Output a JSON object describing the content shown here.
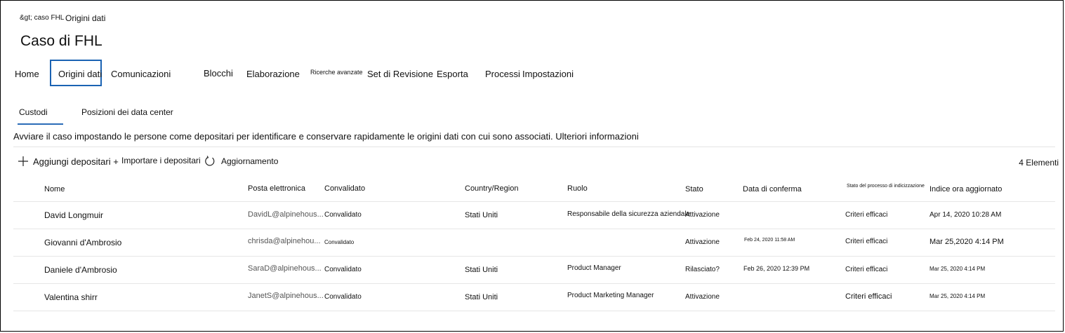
{
  "breadcrumb": {
    "parent": "&gt; caso FHL",
    "current": "Origini dati"
  },
  "page_title": "Caso di FHL",
  "tabs": [
    {
      "label": "Home"
    },
    {
      "label": "Origini dati",
      "selected": true
    },
    {
      "label": "Comunicazioni"
    },
    {
      "label": "Blocchi"
    },
    {
      "label": "Elaborazione"
    },
    {
      "label": "Ricerche avanzate"
    },
    {
      "label": "Set di Revisione"
    },
    {
      "label": "Esporta"
    },
    {
      "label": "Processi"
    },
    {
      "label": "Impostazioni"
    }
  ],
  "subtabs": [
    {
      "label": "Custodi",
      "selected": true
    },
    {
      "label": "Posizioni dei data center"
    }
  ],
  "description": "Avviare il caso impostando le persone come depositari per identificare e conservare rapidamente le origini dati con cui sono associati. Ulteriori informazioni",
  "commands": {
    "add": "Aggiungi depositari +",
    "import": "Importare i depositari",
    "refresh": "Aggiornamento"
  },
  "item_count": "4 Elementi",
  "table": {
    "headers": [
      "Nome",
      "Posta elettronica",
      "Convalidato",
      "Country/Region",
      "Ruolo",
      "Stato",
      "Data di conferma",
      "Stato del processo di indicizzazione",
      "Indice ora aggiornato"
    ],
    "rows": [
      [
        "David Longmuir",
        "DavidL@alpinehous...",
        "Convalidato",
        "Stati Uniti",
        "Responsabile della sicurezza aziendale",
        "Attivazione",
        "",
        "Criteri efficaci",
        "Apr 14, 2020 10:28 AM"
      ],
      [
        "Giovanni d'Ambrosio",
        "chrisda@alpinehou...",
        "Convalidato",
        "",
        "",
        "Attivazione",
        "Feb 24, 2020 11:58 AM",
        "Criteri efficaci",
        "Mar 25,2020 4:14 PM"
      ],
      [
        "Daniele d'Ambrosio",
        "SaraD@alpinehous...",
        "Convalidato",
        "Stati Uniti",
        "Product Manager",
        "Rilasciato?",
        "Feb 26, 2020 12:39 PM",
        "Criteri efficaci",
        "Mar 25, 2020 4:14 PM"
      ],
      [
        "Valentina shirr",
        "JanetS@alpinehous...",
        "Convalidato",
        "Stati Uniti",
        "Product Marketing Manager",
        "Attivazione",
        "",
        "Criteri efficaci",
        "Mar 25, 2020 4:14 PM"
      ]
    ]
  },
  "colors": {
    "accent": "#1b63b3",
    "border": "#000000",
    "divider": "#e6e6e6"
  }
}
